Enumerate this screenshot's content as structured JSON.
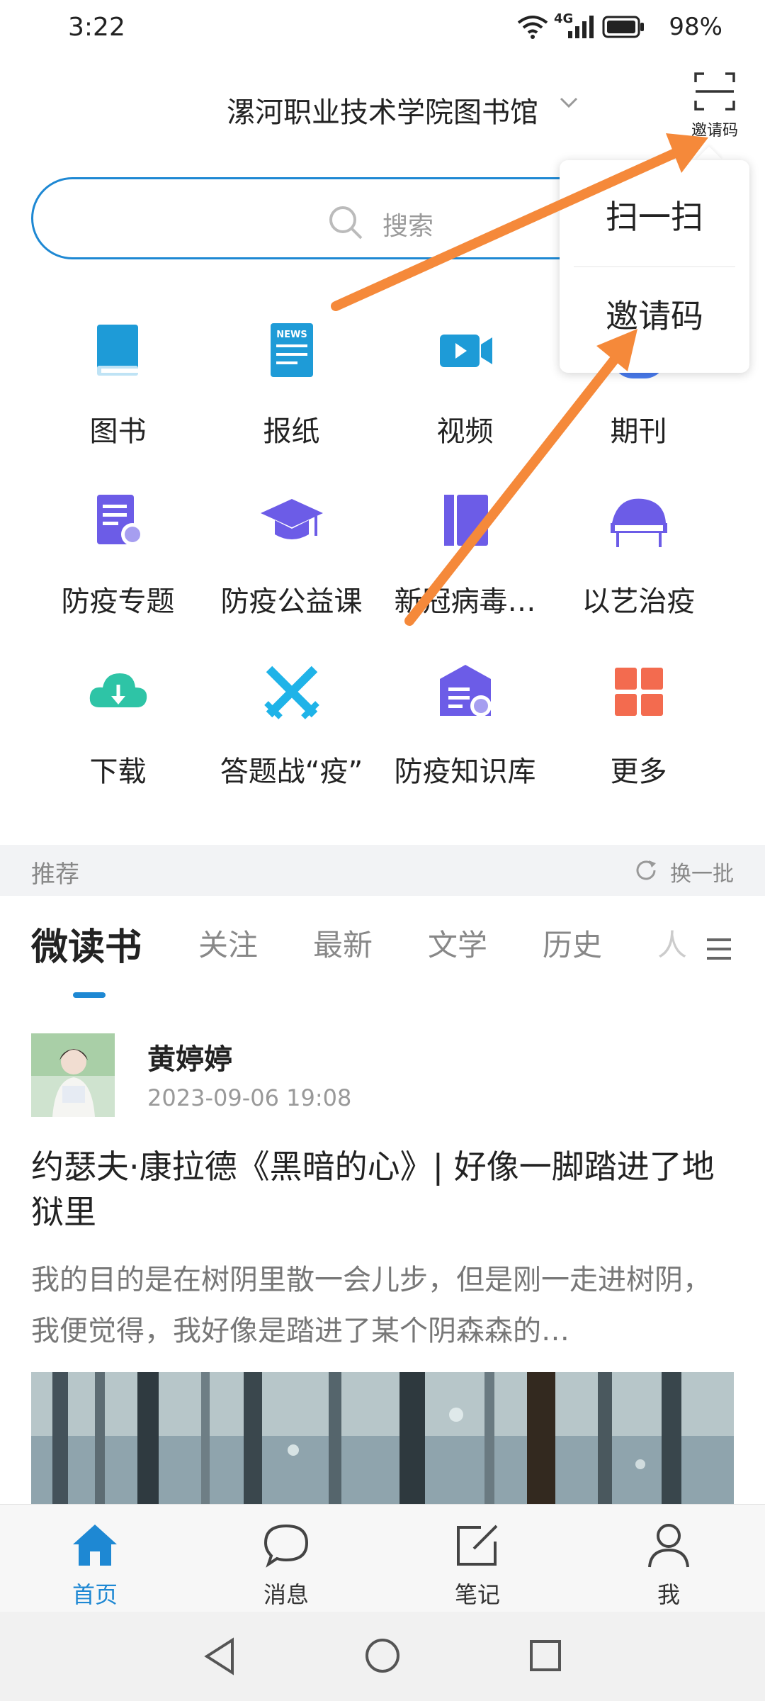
{
  "status_bar": {
    "time": "3:22",
    "network": "4G",
    "battery": "98%"
  },
  "header": {
    "library_name": "漯河职业技术学院图书馆",
    "scan_button_label": "邀请码"
  },
  "search": {
    "placeholder": "搜索"
  },
  "popup_menu": {
    "items": [
      "扫一扫",
      "邀请码"
    ]
  },
  "grid": {
    "items": [
      {
        "label": "图书",
        "icon": "book-icon",
        "color": "#1e9bd7"
      },
      {
        "label": "报纸",
        "icon": "newspaper-icon",
        "color": "#1e9bd7"
      },
      {
        "label": "视频",
        "icon": "video-icon",
        "color": "#1e9bd7"
      },
      {
        "label": "期刊",
        "icon": "journal-icon",
        "color": "#4a7cf0"
      },
      {
        "label": "防疫专题",
        "icon": "epidemic-topic-icon",
        "color": "#6c5ce7"
      },
      {
        "label": "防疫公益课",
        "icon": "graduation-cap-icon",
        "color": "#6c5ce7"
      },
      {
        "label": "新冠病毒…",
        "icon": "virus-book-icon",
        "color": "#6c5ce7"
      },
      {
        "label": "以艺治疫",
        "icon": "piano-icon",
        "color": "#6c5ce7"
      },
      {
        "label": "下载",
        "icon": "cloud-download-icon",
        "color": "#2ec4a6"
      },
      {
        "label": "答题战“疫”",
        "icon": "crossed-swords-icon",
        "color": "#1fb3e8"
      },
      {
        "label": "防疫知识库",
        "icon": "knowledge-base-icon",
        "color": "#6c5ce7"
      },
      {
        "label": "更多",
        "icon": "more-grid-icon",
        "color": "#f36b4f"
      }
    ]
  },
  "recommend": {
    "title": "推荐",
    "refresh_label": "换一批"
  },
  "tabs": [
    "微读书",
    "关注",
    "最新",
    "文学",
    "历史",
    "人"
  ],
  "post": {
    "author": "黄婷婷",
    "time": "2023-09-06 19:08",
    "title": "约瑟夫·康拉德《黑暗的心》| 好像一脚踏进了地狱里",
    "excerpt": "我的目的是在树阴里散一会儿步，但是刚一走进树阴，我便觉得，我好像是踏进了某个阴森森的…"
  },
  "bottom_nav": [
    {
      "label": "首页",
      "icon": "home-icon",
      "active": true
    },
    {
      "label": "消息",
      "icon": "message-icon",
      "active": false
    },
    {
      "label": "笔记",
      "icon": "note-icon",
      "active": false
    },
    {
      "label": "我",
      "icon": "profile-icon",
      "active": false
    }
  ],
  "colors": {
    "accent": "#1e88d3",
    "annotation_arrow": "#f5893a"
  }
}
